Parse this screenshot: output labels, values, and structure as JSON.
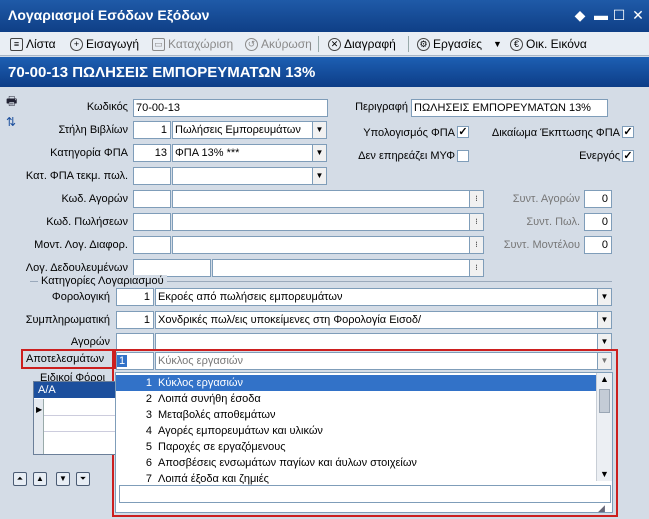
{
  "window": {
    "title": "Λογαριασμοί Εσόδων Εξόδων",
    "buttons": [
      "◆",
      "▬",
      "☐",
      "✕"
    ]
  },
  "toolbar": {
    "list": "Λίστα",
    "insert": "Εισαγωγή",
    "save": "Καταχώριση",
    "cancel": "Ακύρωση",
    "delete": "Διαγραφή",
    "tasks": "Εργασίες",
    "financial": "Οικ. Εικόνα"
  },
  "header": {
    "title": "70-00-13 ΠΩΛΗΣΕΙΣ ΕΜΠΟΡΕΥΜΑΤΩΝ 13%"
  },
  "form": {
    "code": {
      "label": "Κωδικός",
      "value": "70-00-13"
    },
    "description": {
      "label": "Περιγραφή",
      "value": "ΠΩΛΗΣΕΙΣ ΕΜΠΟΡΕΥΜΑΤΩΝ 13%"
    },
    "books_column": {
      "label": "Στήλη Βιβλίων",
      "num": "1",
      "value": "Πωλήσεις Εμπορευμάτων"
    },
    "vat_calc": {
      "label": "Υπολογισμός ΦΠΑ",
      "checked": true
    },
    "vat_deduct": {
      "label": "Δικαίωμα Έκπτωσης ΦΠΑ",
      "checked": true
    },
    "vat_category": {
      "label": "Κατηγορία ΦΠΑ",
      "num": "13",
      "value": "ΦΠΑ 13% ***"
    },
    "myf": {
      "label": "Δεν επηρεάζει ΜΥΦ",
      "checked": false
    },
    "active": {
      "label": "Ενεργός",
      "checked": true
    },
    "vat_cat_sale": {
      "label": "Κατ. ΦΠΑ τεκμ. πωλ."
    },
    "purchase_code": {
      "label": "Κωδ. Αγορών"
    },
    "sales_code": {
      "label": "Κωδ. Πωλήσεων"
    },
    "diff_code": {
      "label": "Μοντ. Λογ. Διαφορ."
    },
    "accrued": {
      "label": "Λογ. Δεδουλευμένων"
    },
    "coef_purchase": {
      "label": "Συντ. Αγορών",
      "value": "0"
    },
    "coef_sales": {
      "label": "Συντ. Πωλ.",
      "value": "0"
    },
    "coef_model": {
      "label": "Συντ. Μοντέλου",
      "value": "0"
    }
  },
  "categories": {
    "title": "Κατηγορίες Λογαριασμού",
    "tax": {
      "label": "Φορολογική",
      "num": "1",
      "value": "Εκροές από πωλήσεις εμπορευμάτων"
    },
    "supplementary": {
      "label": "Συμπληρωματική",
      "num": "1",
      "value": "Χονδρικές πωλ/εις υποκείμενες στη Φορολογία Εισοδ/"
    },
    "purchases": {
      "label": "Αγορών"
    },
    "results": {
      "label": "Αποτελεσμάτων",
      "num": "1",
      "value": "Κύκλος εργασιών"
    }
  },
  "special_taxes": {
    "title": "Ειδικοί Φόροι",
    "col": "Α/Α"
  },
  "dropdown": {
    "items": [
      {
        "num": "1",
        "label": "Κύκλος εργασιών"
      },
      {
        "num": "2",
        "label": "Λοιπά συνήθη έσοδα"
      },
      {
        "num": "3",
        "label": "Μεταβολές αποθεμάτων"
      },
      {
        "num": "4",
        "label": "Αγορές εμπορευμάτων και υλικών"
      },
      {
        "num": "5",
        "label": "Παροχές σε εργαζόμενους"
      },
      {
        "num": "6",
        "label": "Αποσβέσεις ενσωμάτων παγίων και άυλων στοιχείων"
      },
      {
        "num": "7",
        "label": "Λοιπά έξοδα και ζημιές"
      }
    ]
  },
  "colors": {
    "title_bg": "#0f3f86",
    "selection": "#3272c8",
    "highlight": "#cc1f1f"
  }
}
